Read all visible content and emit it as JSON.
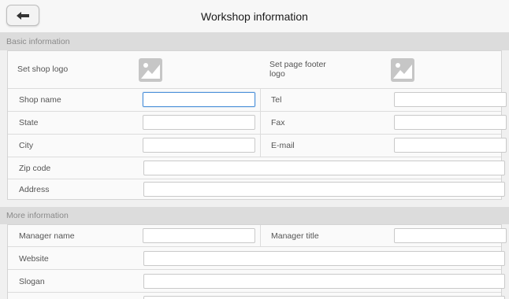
{
  "header": {
    "title": "Workshop information",
    "back_icon": "arrow-left-icon"
  },
  "basic": {
    "section_title": "Basic information",
    "shop_logo_label": "Set shop logo",
    "footer_logo_label_line1": "Set page footer",
    "footer_logo_label_line2": "logo",
    "shop_name_label": "Shop name",
    "tel_label": "Tel",
    "state_label": "State",
    "fax_label": "Fax",
    "city_label": "City",
    "email_label": "E-mail",
    "zip_label": "Zip code",
    "address_label": "Address"
  },
  "more": {
    "section_title": "More information",
    "manager_name_label": "Manager name",
    "manager_title_label": "Manager title",
    "website_label": "Website",
    "slogan_label": "Slogan"
  }
}
